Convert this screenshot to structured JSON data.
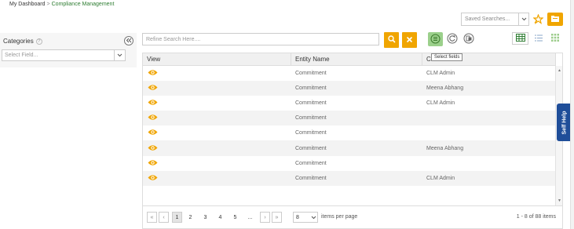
{
  "breadcrumb": {
    "home": "My Dashboard",
    "separator": ">",
    "current": "Compliance Management"
  },
  "saved_searches": {
    "placeholder": "Saved Searches..."
  },
  "sidebar": {
    "title": "Categories",
    "select_placeholder": "Select Field..."
  },
  "search": {
    "placeholder": "Refine Search Here...."
  },
  "tooltip": {
    "text": "Select fields"
  },
  "grid": {
    "columns": [
      "View",
      "Entity Name",
      "C"
    ],
    "rows": [
      {
        "entity": "Commitment",
        "user": "CLM Admin"
      },
      {
        "entity": "Commitment",
        "user": "Meena Abhang"
      },
      {
        "entity": "Commitment",
        "user": "CLM Admin"
      },
      {
        "entity": "Commitment",
        "user": ""
      },
      {
        "entity": "Commitment",
        "user": ""
      },
      {
        "entity": "Commitment",
        "user": "Meena Abhang"
      },
      {
        "entity": "Commitment",
        "user": ""
      },
      {
        "entity": "Commitment",
        "user": "CLM Admin"
      }
    ]
  },
  "pager": {
    "first": "«",
    "prev": "‹",
    "next": "›",
    "last": "»",
    "pages": [
      "1",
      "2",
      "3",
      "4",
      "5",
      "..."
    ],
    "active_page": "1",
    "per_page": "8",
    "per_page_label": "items per page",
    "count": "1 - 8 of 88 items"
  },
  "self_help": {
    "label": "Self Help"
  },
  "colors": {
    "accent": "#f0a500",
    "green": "#2e7d32",
    "self_help": "#1f4e99",
    "select_fields": "#9bd08b"
  },
  "icons": [
    "eye-icon",
    "search-icon",
    "close-icon",
    "star-icon",
    "folder-icon",
    "refresh-icon",
    "export-icon",
    "grid-view-icon",
    "list-view-icon",
    "tile-view-icon"
  ]
}
